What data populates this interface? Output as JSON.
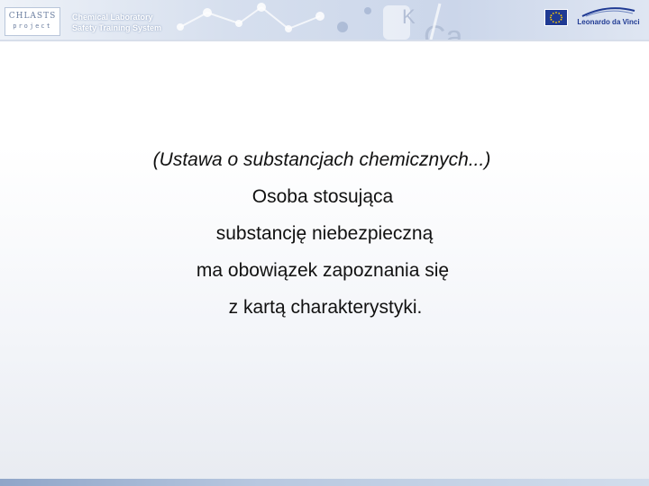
{
  "header": {
    "logo_main": "CHLASTS",
    "logo_sub": "project",
    "title_line1": "Chemical Laboratory",
    "title_line2": "Safety Training System",
    "partner_text": "Leonardo da Vinci"
  },
  "slide": {
    "line1": "(Ustawa o substancjach chemicznych...)",
    "line2": "Osoba stosująca",
    "line3": "substancję niebezpieczną",
    "line4": "ma obowiązek zapoznania się",
    "line5": "z kartą charakterystyki."
  },
  "colors": {
    "header_bg": "#cbd6ea",
    "eu_blue": "#1f3a93",
    "eu_star": "#ffcc00",
    "text": "#111111"
  },
  "icons": {
    "eu_flag": "eu-flag-icon",
    "partner_logo": "leonardo-da-vinci-logo"
  }
}
